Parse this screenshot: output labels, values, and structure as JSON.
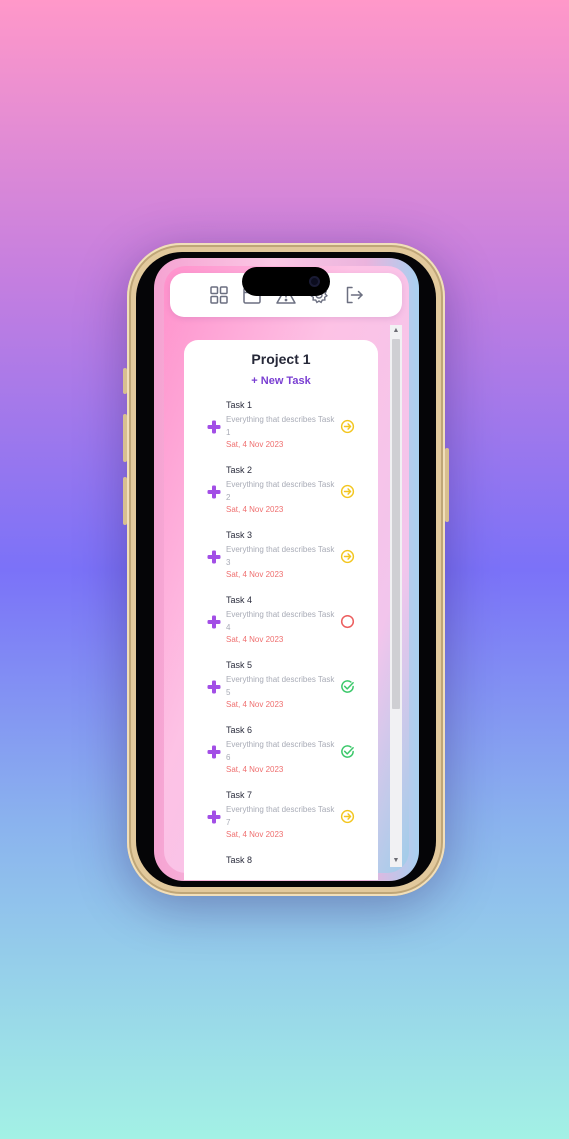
{
  "toolbar": {
    "icons": [
      "grid-icon",
      "calendar-icon",
      "warning-icon",
      "gear-icon",
      "logout-icon"
    ]
  },
  "project": {
    "title": "Project 1",
    "new_task_label": "+ New Task"
  },
  "tasks": [
    {
      "name": "Task 1",
      "description": "Everything that describes Task 1",
      "date": "Sat, 4 Nov 2023",
      "status": "in-progress"
    },
    {
      "name": "Task 2",
      "description": "Everything that describes Task 2",
      "date": "Sat, 4 Nov 2023",
      "status": "in-progress"
    },
    {
      "name": "Task 3",
      "description": "Everything that describes Task 3",
      "date": "Sat, 4 Nov 2023",
      "status": "in-progress"
    },
    {
      "name": "Task 4",
      "description": "Everything that describes Task 4",
      "date": "Sat, 4 Nov 2023",
      "status": "not-started"
    },
    {
      "name": "Task 5",
      "description": "Everything that describes Task 5",
      "date": "Sat, 4 Nov 2023",
      "status": "done"
    },
    {
      "name": "Task 6",
      "description": "Everything that describes Task 6",
      "date": "Sat, 4 Nov 2023",
      "status": "done"
    },
    {
      "name": "Task 7",
      "description": "Everything that describes Task 7",
      "date": "Sat, 4 Nov 2023",
      "status": "in-progress"
    },
    {
      "name": "Task 8",
      "description": "",
      "date": "",
      "status": ""
    }
  ],
  "colors": {
    "accent_purple": "#7a3fd2",
    "plus_purple": "#a24ee6",
    "date_red": "#ef6f6f",
    "status_in_progress": "#f3c61f",
    "status_not_started": "#ec5d5d",
    "status_done": "#3bc86a"
  }
}
